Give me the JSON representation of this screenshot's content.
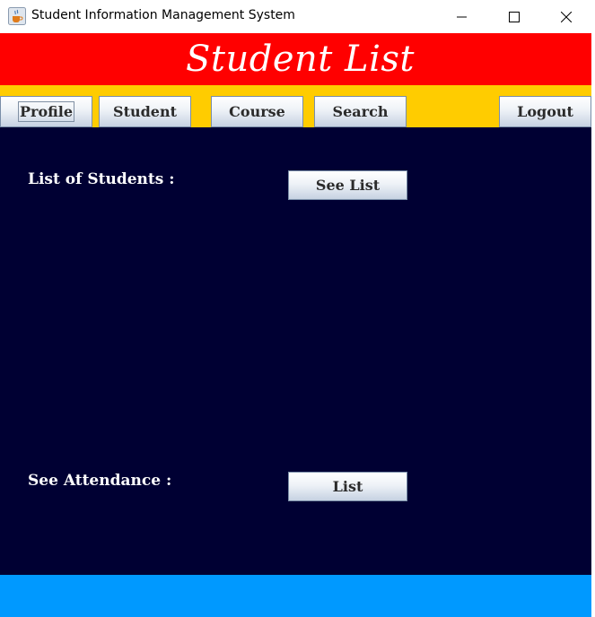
{
  "window": {
    "title": "Student Information Management System",
    "icon": "java-cup-icon"
  },
  "header": {
    "title": "Student List",
    "background": "#ff0000"
  },
  "nav": {
    "background": "#ffcc00",
    "profile_label": "Profile",
    "student_label": "Student",
    "course_label": "Course",
    "search_label": "Search",
    "logout_label": "Logout"
  },
  "main": {
    "background": "#000033",
    "students_label": "List of Students :",
    "see_list_button": "See List",
    "attendance_label": "See Attendance :",
    "list_button": "List"
  },
  "footer": {
    "background": "#0099ff"
  }
}
